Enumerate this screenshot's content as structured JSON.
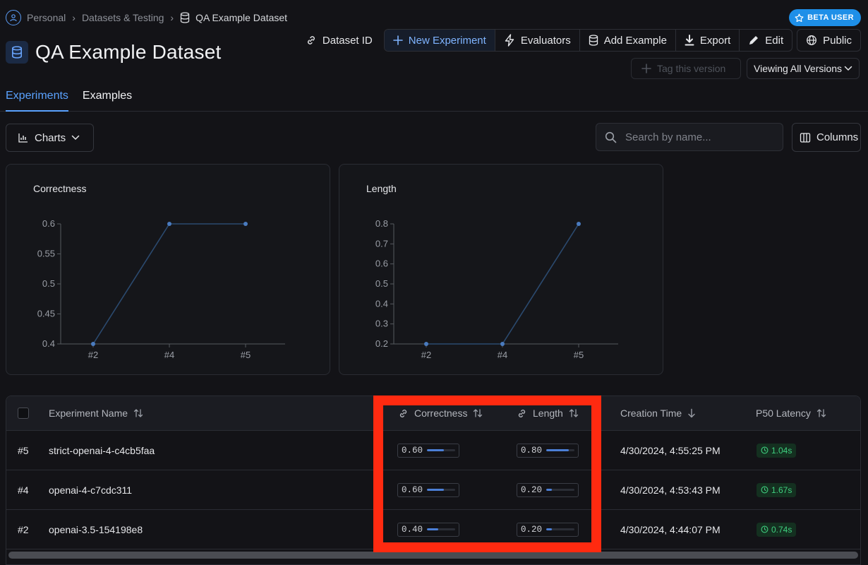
{
  "breadcrumb": {
    "items": [
      "Personal",
      "Datasets & Testing"
    ],
    "current": "QA Example Dataset"
  },
  "badge": {
    "label": "BETA USER"
  },
  "header": {
    "title": "QA Example Dataset"
  },
  "toolbar": {
    "dataset_id": "Dataset ID",
    "new_experiment": "New Experiment",
    "evaluators": "Evaluators",
    "add_example": "Add Example",
    "export": "Export",
    "edit": "Edit",
    "public": "Public",
    "tag_version": "Tag this version",
    "version_select": "Viewing All Versions"
  },
  "tabs": [
    "Experiments",
    "Examples"
  ],
  "active_tab": "Experiments",
  "filters": {
    "charts": "Charts",
    "search_placeholder": "Search by name...",
    "columns": "Columns"
  },
  "charts": [
    {
      "title": "Correctness",
      "categories": [
        "#2",
        "#4",
        "#5"
      ],
      "values": [
        0.4,
        0.6,
        0.6
      ],
      "yticks": [
        "0.6",
        "0.55",
        "0.5",
        "0.45",
        "0.4"
      ],
      "ylim": [
        0.4,
        0.6
      ]
    },
    {
      "title": "Length",
      "categories": [
        "#2",
        "#4",
        "#5"
      ],
      "values": [
        0.2,
        0.2,
        0.8
      ],
      "yticks": [
        "0.8",
        "0.7",
        "0.6",
        "0.5",
        "0.4",
        "0.3",
        "0.2"
      ],
      "ylim": [
        0.2,
        0.8
      ]
    }
  ],
  "chart_data": [
    {
      "type": "line",
      "title": "Correctness",
      "categories": [
        "#2",
        "#4",
        "#5"
      ],
      "values": [
        0.4,
        0.6,
        0.6
      ],
      "ylim": [
        0.4,
        0.6
      ]
    },
    {
      "type": "line",
      "title": "Length",
      "categories": [
        "#2",
        "#4",
        "#5"
      ],
      "values": [
        0.2,
        0.2,
        0.8
      ],
      "ylim": [
        0.2,
        0.8
      ]
    }
  ],
  "table": {
    "columns": {
      "name": "Experiment Name",
      "correctness": "Correctness",
      "length": "Length",
      "creation_time": "Creation Time",
      "p50": "P50 Latency"
    },
    "rows": [
      {
        "id": "#5",
        "name": "strict-openai-4-c4cb5faa",
        "correctness": "0.60",
        "correctness_value": 0.6,
        "length": "0.80",
        "length_value": 0.8,
        "created": "4/30/2024, 4:55:25 PM",
        "latency": "1.04s"
      },
      {
        "id": "#4",
        "name": "openai-4-c7cdc311",
        "correctness": "0.60",
        "correctness_value": 0.6,
        "length": "0.20",
        "length_value": 0.2,
        "created": "4/30/2024, 4:53:43 PM",
        "latency": "1.67s"
      },
      {
        "id": "#2",
        "name": "openai-3.5-154198e8",
        "correctness": "0.40",
        "correctness_value": 0.4,
        "length": "0.20",
        "length_value": 0.2,
        "created": "4/30/2024, 4:44:07 PM",
        "latency": "0.74s"
      }
    ]
  },
  "colors": {
    "accent": "#5aa2ff",
    "highlight": "#ff2a10",
    "line": "#2b4a6f",
    "latency_text": "#3fcf7f"
  }
}
